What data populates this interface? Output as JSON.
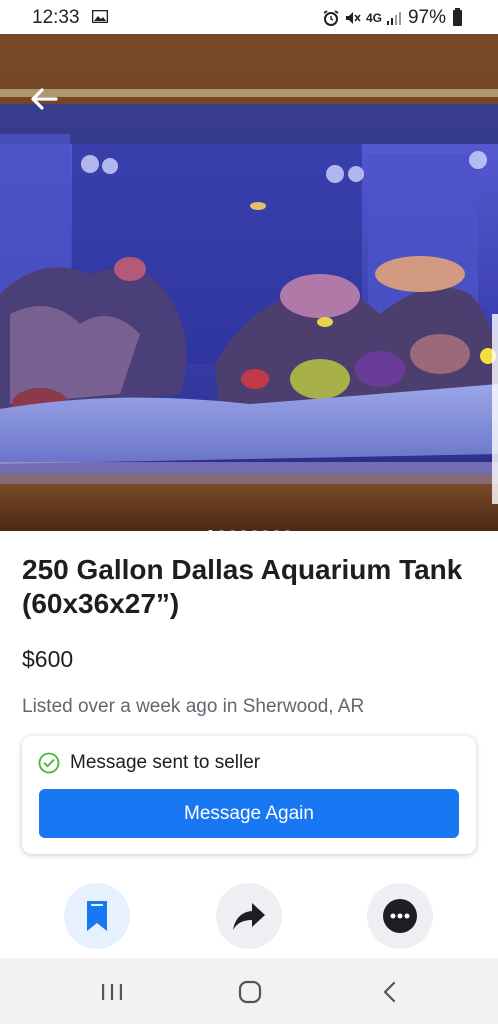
{
  "status_bar": {
    "time": "12:33",
    "network": "4G",
    "battery": "97%"
  },
  "listing": {
    "title": "250 Gallon Dallas Aquarium Tank (60x36x27”)",
    "price": "$600",
    "listed_text": "Listed over a week ago in Sherwood, AR",
    "photo_count": 8,
    "current_photo_index": 1
  },
  "message_card": {
    "status_text": "Message sent to seller",
    "button_label": "Message Again"
  },
  "actions": [
    {
      "name": "save-button",
      "icon": "bookmark-icon"
    },
    {
      "name": "share-button",
      "icon": "share-arrow-icon"
    },
    {
      "name": "more-button",
      "icon": "more-dots-icon"
    }
  ],
  "nav_bar": [
    "recent-apps-icon",
    "home-icon",
    "back-nav-icon"
  ],
  "colors": {
    "accent": "#1877f2",
    "success": "#42b72a",
    "save_bg": "#e7f0fd"
  }
}
